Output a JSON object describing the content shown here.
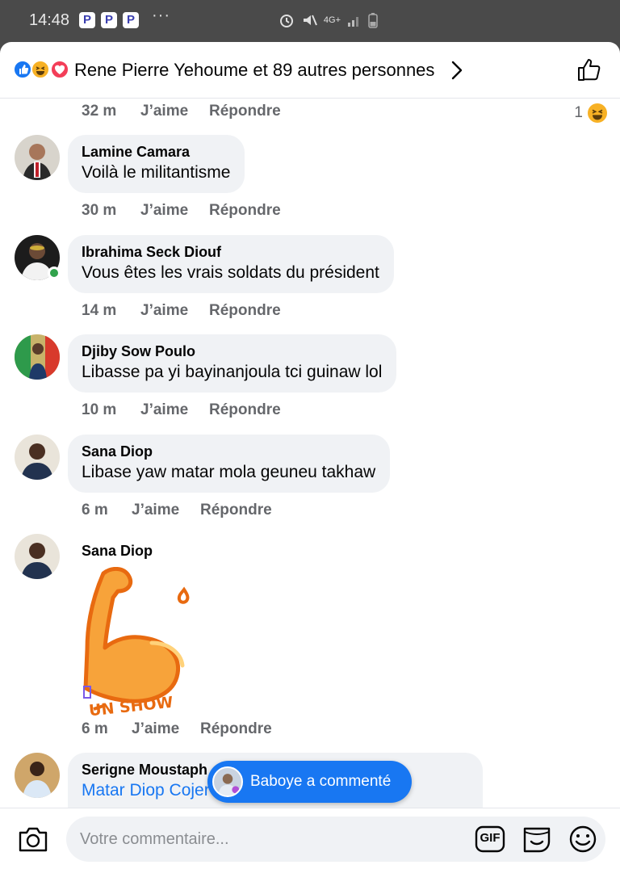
{
  "status_bar": {
    "time": "14:48",
    "apps": [
      "P",
      "P",
      "P"
    ],
    "more": "···",
    "network": "4G+"
  },
  "header": {
    "reactions": [
      "like-icon",
      "haha-icon",
      "love-icon"
    ],
    "title": "Rene Pierre Yehoume et 89 autres personnes"
  },
  "labels": {
    "like": "J’aime",
    "reply": "Répondre"
  },
  "comments": [
    {
      "name": "",
      "text": "",
      "time": "32 m",
      "reaction_count": "1"
    },
    {
      "name": "Lamine Camara",
      "text": "Voilà le militantisme",
      "time": "30 m"
    },
    {
      "name": "Ibrahima Seck Diouf",
      "text": "Vous êtes les vrais soldats du président",
      "time": "14 m",
      "online": true
    },
    {
      "name": "Djiby Sow Poulo",
      "text": "Libasse pa yi bayinanjoula tci guinaw lol",
      "time": "10 m"
    },
    {
      "name": "Sana Diop",
      "text": "Libase yaw matar mola geuneu takhaw",
      "time": "6 m"
    },
    {
      "name": "Sana Diop",
      "sticker_caption": "UN SHOW",
      "time": "6 m"
    },
    {
      "name": "Serigne Moustaph",
      "text": "Matar Diop Cojer"
    }
  ],
  "toast": {
    "text": "Baboye a commenté"
  },
  "composer": {
    "placeholder": "Votre commentaire...",
    "gif_label": "GIF"
  },
  "colors": {
    "accent": "#1877f2",
    "bubble": "#f0f2f5",
    "meta_text": "#65676b",
    "sticker_orange": "#f7941d"
  }
}
